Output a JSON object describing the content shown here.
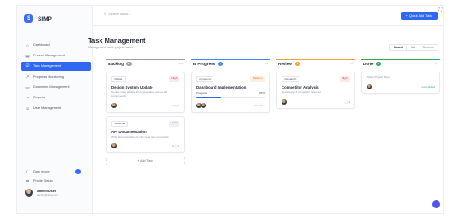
{
  "app": {
    "name": "SIMP"
  },
  "sidebar": {
    "items": [
      {
        "label": "Dashboard",
        "icon": "home-icon",
        "active": false
      },
      {
        "label": "Project Management",
        "icon": "folder-icon",
        "active": false
      },
      {
        "label": "Task Management",
        "icon": "tasks-icon",
        "active": true
      },
      {
        "label": "Progress Monitoring",
        "icon": "chart-icon",
        "active": false
      },
      {
        "label": "Document Management",
        "icon": "document-icon",
        "active": false
      },
      {
        "label": "Reports",
        "icon": "report-icon",
        "active": false
      },
      {
        "label": "User Management",
        "icon": "users-icon",
        "active": false
      }
    ],
    "bottom": {
      "dark_mode_label": "Dark mode",
      "profile_label": "Profile Setup",
      "user_name": "Admin User",
      "user_email": "admin@simp.com"
    }
  },
  "header": {
    "search_placeholder": "Search tasks...",
    "add_button_label": "+ Quick Add Task"
  },
  "page": {
    "title": "Task Management",
    "subtitle": "Manage and track project tasks",
    "views": [
      "Board",
      "List",
      "Timeline"
    ]
  },
  "columns": [
    {
      "name": "Backlog",
      "count": "2",
      "accent": "#9aa0ad",
      "cards": [
        {
          "tag": "Mobile",
          "priority": "High",
          "priority_level": "high",
          "title": "Design System Update",
          "desc": "Update color palette and typography across all components",
          "meta": "2 ▢ 1"
        },
        {
          "tag": "Backend",
          "priority": "Low",
          "priority_level": "low",
          "title": "API Documentation",
          "desc": "Write documentation for the new user endpoints",
          "meta": "0 ▢ 0"
        }
      ],
      "add_label": "+ Add Task"
    },
    {
      "name": "In Progress",
      "count": "1",
      "accent": "#3b8ef0",
      "cards": [
        {
          "tag": "Frontend",
          "priority": "Medium",
          "priority_level": "high",
          "title": "Dashboard Implementation",
          "progress_label": "Progress",
          "progress_value": "35%",
          "progress": 0.35,
          "due": "Overdue"
        }
      ]
    },
    {
      "name": "Review",
      "count": "1",
      "accent": "#f0a13b",
      "cards": [
        {
          "tag": "Research",
          "priority": "High",
          "priority_level": "high",
          "title": "Competitor Analysis",
          "desc": "Review top 5 competitor features",
          "meta": "▢ 3"
        }
      ]
    },
    {
      "name": "Done",
      "count": "1",
      "accent": "#2fa85b",
      "cards": [
        {
          "tag": "",
          "priority": "",
          "title": "",
          "desc": "Setup Project Repo",
          "done": "Completed"
        }
      ]
    }
  ]
}
